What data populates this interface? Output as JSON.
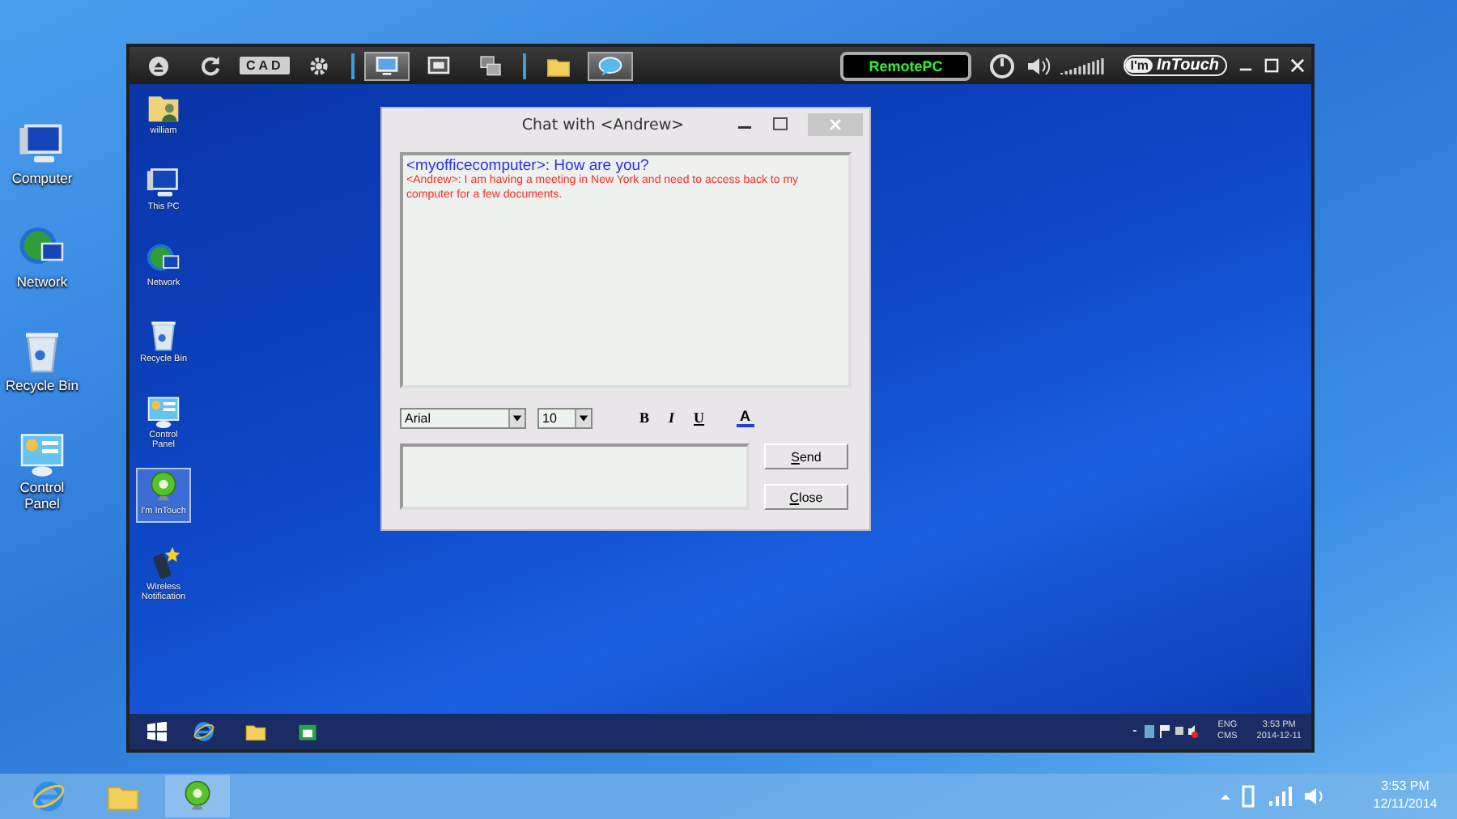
{
  "desktop": {
    "icons": [
      {
        "kind": "computer",
        "label": "Computer",
        "selected": false
      },
      {
        "kind": "globe",
        "label": "Network",
        "selected": false
      },
      {
        "kind": "trash",
        "label": "Recycle Bin",
        "selected": false
      },
      {
        "kind": "panel",
        "label": "Control Panel",
        "selected": false
      }
    ]
  },
  "remote_window": {
    "toolbar": {
      "buttons": [
        {
          "kind": "eject",
          "selected": false
        },
        {
          "kind": "refresh",
          "selected": false
        },
        {
          "kind": "text",
          "label": "CAD",
          "selected": false
        },
        {
          "kind": "gear",
          "selected": false
        },
        {
          "kind": "separator"
        },
        {
          "kind": "monitor",
          "selected": true
        },
        {
          "kind": "screen",
          "selected": false
        },
        {
          "kind": "windows",
          "selected": false
        },
        {
          "kind": "separator"
        },
        {
          "kind": "folder",
          "selected": false
        },
        {
          "kind": "chat",
          "selected": true
        }
      ],
      "status_badge": "RemotePC",
      "logo_badge": "I'm",
      "logo_text": "InTouch"
    },
    "desktop_icons": [
      {
        "kind": "userfolder",
        "label": "william",
        "selected": false
      },
      {
        "kind": "computer",
        "label": "This PC",
        "selected": false
      },
      {
        "kind": "globe",
        "label": "Network",
        "selected": false
      },
      {
        "kind": "trash",
        "label": "Recycle Bin",
        "selected": false
      },
      {
        "kind": "panel",
        "label": "Control Panel",
        "selected": false
      },
      {
        "kind": "webcam",
        "label": "I'm InTouch",
        "selected": true
      },
      {
        "kind": "phone",
        "label": "Wireless Notification",
        "selected": false
      }
    ],
    "taskbar": {
      "apps": [
        {
          "kind": "ie",
          "selected": false
        },
        {
          "kind": "folder",
          "selected": false
        },
        {
          "kind": "store",
          "selected": false
        }
      ],
      "tray": {
        "language": "ENG",
        "input": "CMS",
        "time": "3:53 PM",
        "date": "2014-12-11"
      }
    }
  },
  "chat_window": {
    "title": "Chat with <Andrew>",
    "messages": [
      {
        "kind": "local",
        "sender": "<myofficecomputer>",
        "text": ": How are you?",
        "color": "#2b2bff"
      },
      {
        "kind": "remote",
        "sender": "<Andrew>",
        "text": ": I am having a meeting in New York and need to access back to my computer for a few documents.",
        "color": "#ff2a2a"
      }
    ],
    "font": "Arial",
    "size": "10",
    "format_buttons": [
      "B",
      "I",
      "U",
      "A"
    ],
    "buttons": [
      "Send",
      "Close"
    ]
  },
  "taskbar": {
    "apps": [
      {
        "kind": "ie",
        "selected": false
      },
      {
        "kind": "folder",
        "selected": false
      },
      {
        "kind": "webcam",
        "selected": true
      }
    ],
    "tray": {
      "time": "3:53 PM",
      "date": "12/11/2014"
    }
  }
}
